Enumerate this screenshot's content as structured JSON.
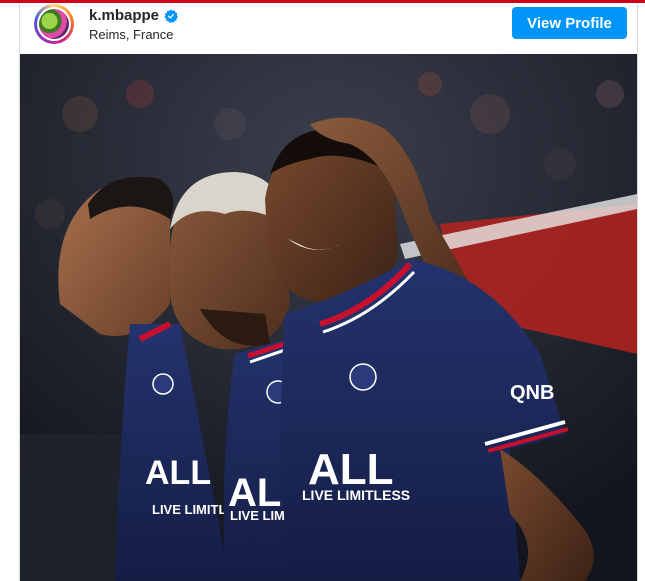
{
  "post": {
    "username": "k.mbappe",
    "location": "Reims, France",
    "view_profile_label": "View Profile",
    "verified": true
  },
  "photo": {
    "jersey_sponsor": "ALL",
    "jersey_tagline": "LIVE LIMITLESS",
    "sleeve_logo": "QNB"
  },
  "colors": {
    "accent_top_bar": "#d0021b",
    "button": "#0095f6",
    "verified_badge": "#0095f6",
    "jersey_navy": "#1d2c63",
    "stripe_red": "#c8102e"
  },
  "icons": {
    "verified": "verified-badge-icon"
  }
}
